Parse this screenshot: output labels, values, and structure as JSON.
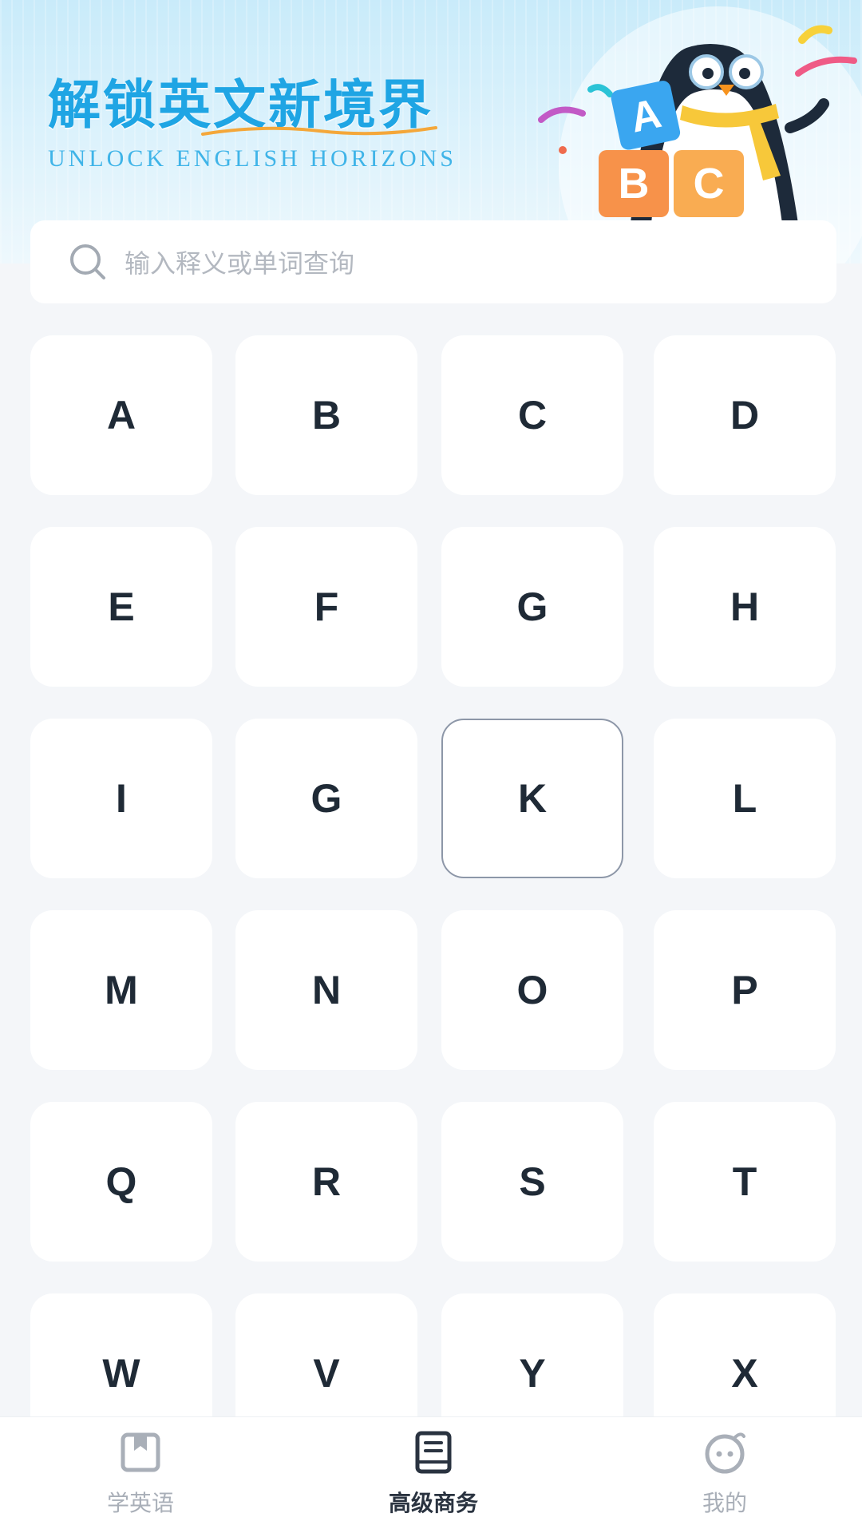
{
  "banner": {
    "title": "解锁英文新境界",
    "subtitle": "UNLOCK ENGLISH HORIZONS",
    "block_letters": [
      "A",
      "B",
      "C"
    ]
  },
  "search": {
    "placeholder": "输入释义或单词查询"
  },
  "letters": [
    "A",
    "B",
    "C",
    "D",
    "E",
    "F",
    "G",
    "H",
    "I",
    "G",
    "K",
    "L",
    "M",
    "N",
    "O",
    "P",
    "Q",
    "R",
    "S",
    "T",
    "W",
    "V",
    "Y",
    "X"
  ],
  "selected_letter_index": 10,
  "tabs": [
    {
      "label": "学英语",
      "icon": "bookmark-book-icon",
      "active": false
    },
    {
      "label": "高级商务",
      "icon": "book-icon",
      "active": true
    },
    {
      "label": "我的",
      "icon": "smiley-face-icon",
      "active": false
    }
  ],
  "colors": {
    "title_blue": "#1fa5e4",
    "key_text": "#1f2a36",
    "tab_active": "#2a3340",
    "tab_inactive": "#a9afb8",
    "block_blue": "#3aa6f0",
    "block_orange": "#f7924a"
  }
}
